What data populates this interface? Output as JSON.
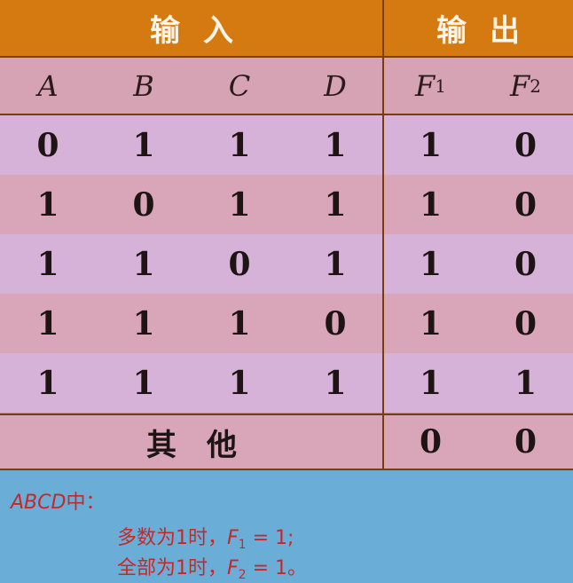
{
  "table": {
    "header": {
      "inputs_label": "输入",
      "outputs_label": "输出"
    },
    "columns": [
      {
        "base": "A",
        "sub": ""
      },
      {
        "base": "B",
        "sub": ""
      },
      {
        "base": "C",
        "sub": ""
      },
      {
        "base": "D",
        "sub": ""
      },
      {
        "base": "F",
        "sub": "1"
      },
      {
        "base": "F",
        "sub": "2"
      }
    ],
    "rows": [
      [
        "0",
        "1",
        "1",
        "1",
        "1",
        "0"
      ],
      [
        "1",
        "0",
        "1",
        "1",
        "1",
        "0"
      ],
      [
        "1",
        "1",
        "0",
        "1",
        "1",
        "0"
      ],
      [
        "1",
        "1",
        "1",
        "0",
        "1",
        "0"
      ],
      [
        "1",
        "1",
        "1",
        "1",
        "1",
        "1"
      ]
    ],
    "other_row": {
      "label": "其他",
      "F1": "0",
      "F2": "0"
    }
  },
  "note": {
    "prefix_vars": "ABCD",
    "prefix_suffix": "中：",
    "line2_text": "多数为1时，",
    "line2_var": "F",
    "line2_sub": "1",
    "line2_eq": " = 1;",
    "line3_text": "全部为1时，",
    "line3_var": "F",
    "line3_sub": "2",
    "line3_eq": " = 1。"
  },
  "colors": {
    "header_orange": "#d47a10",
    "row_light": "#d7b2d8",
    "row_dark": "#d8a6b8",
    "note_background": "#6aaed8",
    "note_text_red": "#c62828",
    "divider_brown": "#7a3d0a"
  }
}
